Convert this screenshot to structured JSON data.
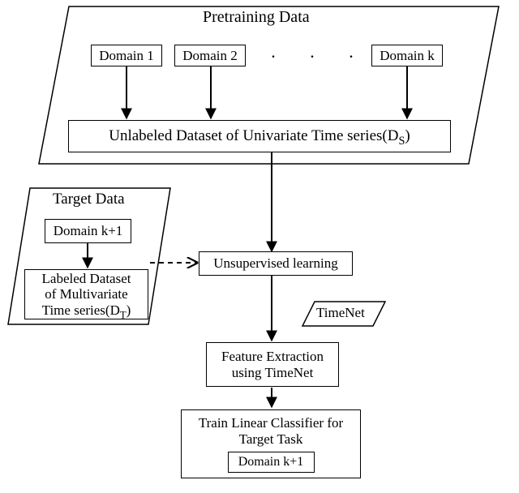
{
  "pretraining": {
    "title": "Pretraining Data",
    "domain1": "Domain 1",
    "domain2": "Domain 2",
    "dots": ". . .",
    "domainK": "Domain k",
    "unlabeled": "Unlabeled Dataset of Univariate Time series(D",
    "unlabeled_sub": "S",
    "unlabeled_close": ")"
  },
  "target": {
    "title": "Target Data",
    "domain": "Domain k+1",
    "labeled_l1": "Labeled Dataset",
    "labeled_l2": "of Multivariate",
    "labeled_l3": "Time series(D",
    "labeled_sub": "T",
    "labeled_close": ")"
  },
  "flow": {
    "unsupervised": "Unsupervised learning",
    "timenet": "TimeNet",
    "feature_l1": "Feature Extraction",
    "feature_l2": "using TimeNet",
    "train_l1": "Train Linear Classifier for",
    "train_l2": "Target Task",
    "train_domain": "Domain k+1"
  }
}
